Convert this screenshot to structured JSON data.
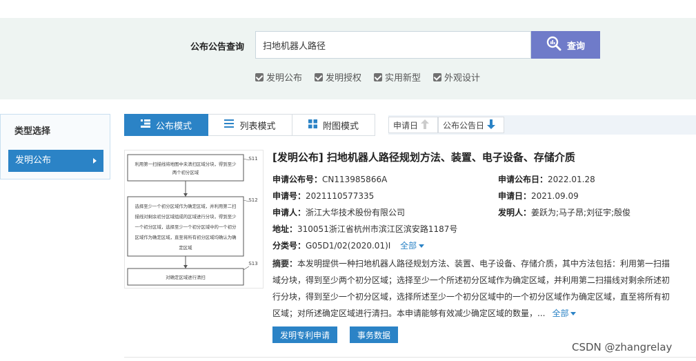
{
  "search": {
    "label": "公布公告查询",
    "value": "扫地机器人路径",
    "button_label": "查询",
    "filters": [
      "发明公布",
      "发明授权",
      "实用新型",
      "外观设计"
    ],
    "accent": "#6f7bc9"
  },
  "sidebar": {
    "title": "类型选择",
    "items": [
      {
        "label": "发明公布",
        "active": true
      }
    ]
  },
  "modes": [
    {
      "label": "公布模式",
      "active": true
    },
    {
      "label": "列表模式",
      "active": false
    },
    {
      "label": "附图模式",
      "active": false
    }
  ],
  "sort": [
    {
      "label": "申请日"
    },
    {
      "label": "公布公告日"
    }
  ],
  "result": {
    "title": "[发明公布] 扫地机器人路径规划方法、装置、电子设备、存储介质",
    "pub_no_label": "申请公布号：",
    "pub_no": "CN113985866A",
    "pub_date_label": "申请公布日：",
    "pub_date": "2022.01.28",
    "app_no_label": "申请号：",
    "app_no": "2021110577335",
    "app_date_label": "申请日：",
    "app_date": "2021.09.09",
    "applicant_label": "申请人：",
    "applicant": "浙江大华技术股份有限公司",
    "inventor_label": "发明人：",
    "inventor": "姜跃为;马子昂;刘征宇;殷俊",
    "address_label": "地址：",
    "address": "310051浙江省杭州市滨江区滨安路1187号",
    "class_label": "分类号：",
    "class_no": "G05D1/02(2020.01)I",
    "class_more": "全部",
    "abstract_label": "摘要：",
    "abstract_lines": [
      "本发明提供一种扫地机器人路径规划方法、装置、电子设备、存储介质，其中方法包括：利用第一扫描",
      "域分块，得到至少两个初分区域；选择至少一个所述初分区域作为确定区域，并利用第二扫描线对剩余所述初",
      "行分块，得到至少一个初分区域，选择所述至少一个初分区域中的一个初分区域作为确定区域，直至将所有初",
      "区域；对所述确定区域进行清扫。本申请能够有效减少确定区域的数量，..."
    ],
    "abstract_more": "全部",
    "buttons": [
      "发明专利申请",
      "事务数据"
    ]
  },
  "figure": {
    "steps": [
      {
        "id": "S11",
        "text": [
          "利用第一扫描线将地图中未清扫区域分块，得到至少",
          "两个初分区域"
        ]
      },
      {
        "id": "S12",
        "text": [
          "选择至少一个初分区域作为确定区域，并利用第二扫",
          "描线对剩余初分区域组成的区域进行分块，得到至少",
          "一个初分区域，选择至少一个初分区域中的一个初分",
          "区域作为确定区域，直至将所有初分区域均确认为确",
          "定区域"
        ]
      },
      {
        "id": "S13",
        "text": [
          "对确定区域进行清扫"
        ]
      }
    ]
  },
  "watermark": "CSDN @zhangrelay",
  "colors": {
    "primary": "#2b83c6",
    "band": "#eef4f2"
  }
}
